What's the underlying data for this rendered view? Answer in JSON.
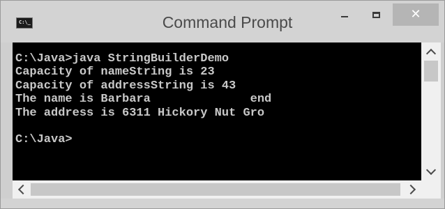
{
  "window": {
    "title": "Command Prompt",
    "icon_label": "C:\\_",
    "icon": "cmd-icon"
  },
  "controls": {
    "minimize_icon": "minimize-icon",
    "maximize_icon": "maximize-icon",
    "close_icon": "close-icon",
    "close_glyph": "✕"
  },
  "console": {
    "background": "#000000",
    "foreground": "#c8c8c8",
    "lines": [
      "C:\\Java>java StringBuilderDemo",
      "Capacity of nameString is 23",
      "Capacity of addressString is 43",
      "The name is Barbara              end",
      "The address is 6311 Hickory Nut Gro",
      "",
      "C:\\Java>"
    ]
  }
}
